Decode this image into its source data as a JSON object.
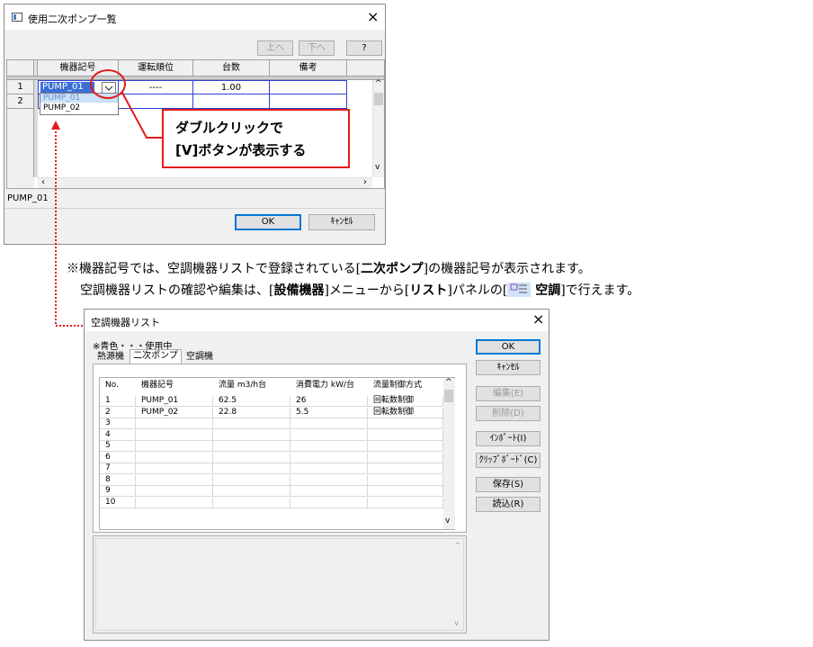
{
  "pump_dialog": {
    "title": "使用二次ポンプ一覧",
    "close": "×",
    "up_button": "上へ",
    "down_button": "下へ",
    "help_button": "?",
    "columns": [
      "機器記号",
      "運転順位",
      "台数",
      "備考"
    ],
    "rows": [
      {
        "no": "1",
        "symbol": "PUMP_01",
        "order": "----",
        "count": "1.00",
        "note": ""
      },
      {
        "no": "2",
        "symbol": "",
        "order": "",
        "count": "",
        "note": ""
      }
    ],
    "dropdown_options": [
      "PUMP_01",
      "PUMP_02"
    ],
    "status_text": "PUMP_01",
    "ok_button": "OK",
    "cancel_button": "ｷｬﾝｾﾙ"
  },
  "callout": {
    "line1": "ダブルクリックで",
    "line2": "[V]ボタンが表示する",
    "color": "#e11b1b"
  },
  "note": {
    "line1_a": "※機器記号では、空調機器リストで登録されている[",
    "line1_b": "二次ポンプ",
    "line1_c": "]の機器記号が表示されます。",
    "line2_a": "空調機器リストの確認や編集は、[",
    "line2_b": "設備機器",
    "line2_c": "]メニューから[",
    "line2_d": "リスト",
    "line2_e": "]パネルの[",
    "line2_f": " 空調",
    "line2_g": "]で行えます。"
  },
  "list_dialog": {
    "title": "空調機器リスト",
    "close": "×",
    "legend": "※青色・・・使用中",
    "tabs": [
      "熱源機",
      "二次ポンプ",
      "空調機"
    ],
    "active_tab": "二次ポンプ",
    "columns": [
      "No.",
      "機器記号",
      "流量 m3/h台",
      "消費電力 kW/台",
      "流量制御方式"
    ],
    "rows": [
      {
        "no": "1",
        "symbol": "PUMP_01",
        "flow": "62.5",
        "power": "26",
        "control": "回転数制御"
      },
      {
        "no": "2",
        "symbol": "PUMP_02",
        "flow": "22.8",
        "power": "5.5",
        "control": "回転数制御"
      },
      {
        "no": "3",
        "symbol": "",
        "flow": "",
        "power": "",
        "control": ""
      },
      {
        "no": "4",
        "symbol": "",
        "flow": "",
        "power": "",
        "control": ""
      },
      {
        "no": "5",
        "symbol": "",
        "flow": "",
        "power": "",
        "control": ""
      },
      {
        "no": "6",
        "symbol": "",
        "flow": "",
        "power": "",
        "control": ""
      },
      {
        "no": "7",
        "symbol": "",
        "flow": "",
        "power": "",
        "control": ""
      },
      {
        "no": "8",
        "symbol": "",
        "flow": "",
        "power": "",
        "control": ""
      },
      {
        "no": "9",
        "symbol": "",
        "flow": "",
        "power": "",
        "control": ""
      },
      {
        "no": "10",
        "symbol": "",
        "flow": "",
        "power": "",
        "control": ""
      }
    ],
    "buttons": {
      "ok": "OK",
      "cancel": "ｷｬﾝｾﾙ",
      "edit": "編集(E)",
      "delete": "削除(D)",
      "import": "ｲﾝﾎﾟｰﾄ(I)",
      "clipboard": "ｸﾘｯﾌﾟﾎﾞｰﾄﾞ(C)",
      "save": "保存(S)",
      "load": "読込(R)"
    }
  },
  "colors": {
    "annotation_red": "#e11b1b",
    "selection_blue": "#2f3fd0",
    "focus_blue": "#0078d7"
  }
}
